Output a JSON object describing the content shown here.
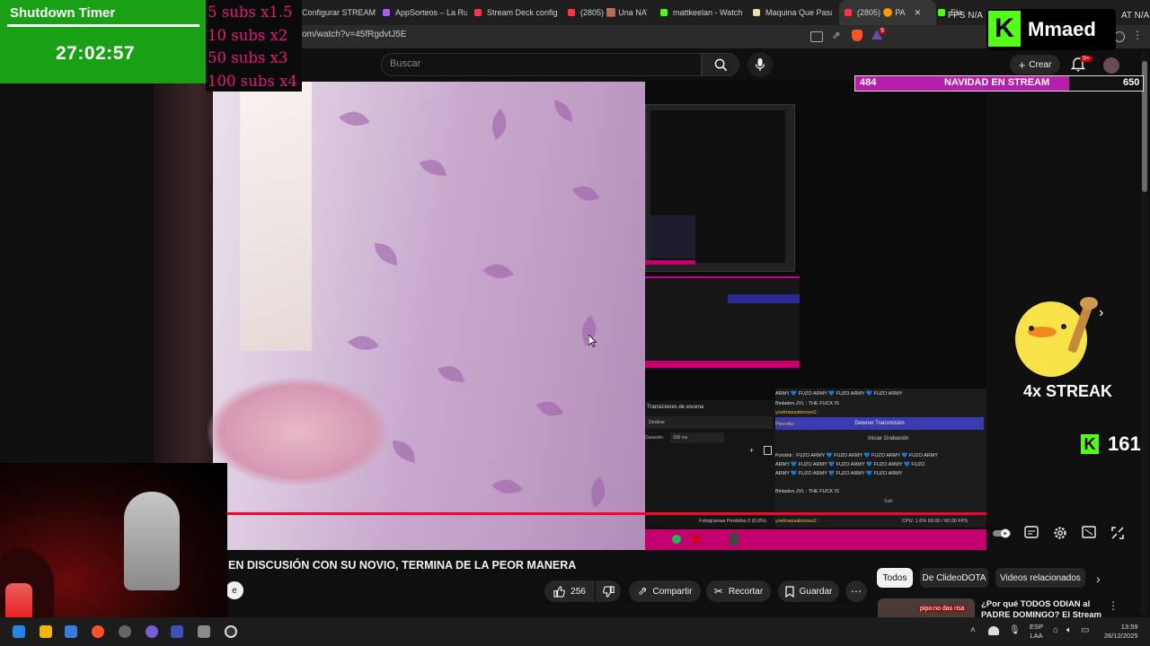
{
  "browser": {
    "tabs": [
      {
        "label": "Configurar STREAM",
        "color": "#9b59ff"
      },
      {
        "label": "AppSorteos – La Ru",
        "color": "#b455ff"
      },
      {
        "label": "Stream Deck config",
        "color": "#ff3344"
      },
      {
        "label": "(2805) 🟫 Una NAV",
        "color": "#ff3344"
      },
      {
        "label": "mattkeelan - Watch",
        "color": "#53fc18"
      },
      {
        "label": "Maquina Que Pasa",
        "color": "#e8e0a8"
      },
      {
        "label": "(2805) 🟠 PA",
        "color": "#ff3344",
        "active": true
      },
      {
        "label": "Ela",
        "color": "#53fc18"
      }
    ],
    "url": "om/watch?v=45fRgdvtJ5E",
    "notif_count": "9"
  },
  "youtube": {
    "search_placeholder": "Buscar",
    "create_label": "Crear",
    "notif_badge": "9+",
    "video_title": "EN DISCUSIÓN CON SU NOVIO, TERMINA DE LA PEOR MANERA",
    "subscribe_frag": "e",
    "actions": {
      "likes": "256",
      "share": "Compartir",
      "clip": "Recortar",
      "save": "Guardar"
    },
    "chips": [
      "Todos",
      "De ClideoDOTA",
      "Videos relacionados"
    ],
    "related": {
      "title": "¿Por qué TODOS ODIAN al PADRE DOMINGO? El Stream",
      "thumb_tag": "pipo:no das risa"
    },
    "progress": 1.0
  },
  "obs": {
    "transitions_title": "Transiciones de escena",
    "transition_type": "Deslizar",
    "duration_label": "Duración",
    "duration_value": "100 ms",
    "stop_stream": "Detener Transmisión",
    "start_recording": "Iniciar Grabación",
    "exit": "Salir",
    "frames": "Fotogramas Perdidos 0 (0,0%)",
    "cpu": "CPU: 1.6%   60.00 / 60.00 FPS",
    "chat_lines": [
      "ARMY 💙 FUZO ARMY 💙 FUZO ARMY 💙 FUZO ARMY",
      "Binladen.JVL : THE FUCK IS",
      "yoelmassabroosx2 :",
      "Pierrettz :",
      "Pzickkk : FUZO ARMY 💙 FUZO ARMY 💙 FUZO ARMY 💙 FUZO ARMY",
      "ARMY 💙 FUZO ARMY 💙 FUZO ARMY 💙 FUZO ARMY 💙 FUZO",
      "ARMY 💙 FUZO ARMY 💙 FUZO ARMY 💙 FUZO ARMY",
      "Binladen.JVL : THE FUCK IS",
      "yoelmassabroosx2 :"
    ]
  },
  "overlay": {
    "timer_title": "Shutdown Timer",
    "timer_value": "27:02:57",
    "subs": [
      "5 subs x1.5",
      "10 subs x2",
      "50 subs x3",
      "100 subs x4"
    ],
    "fps_label": "FPS  N/A",
    "stat_label": "AT  N/A",
    "kick_name": "Mmaed",
    "kick_letter": "K",
    "goal_left": "484",
    "goal_title": "NAVIDAD EN STREAM",
    "goal_right": "650",
    "goal_progress": 0.745,
    "streak": "4x STREAK",
    "kick_count": "161"
  },
  "taskbar": {
    "lang_top": "ESP",
    "lang_bottom": "LAA",
    "time": "13:59",
    "date": "26/12/2025"
  },
  "colors": {
    "accent_red": "#ff0033",
    "timer_green": "#19a015",
    "kick_green": "#53fc18",
    "subs_pink": "#e8197a",
    "goal_purple": "#b81fa8"
  }
}
